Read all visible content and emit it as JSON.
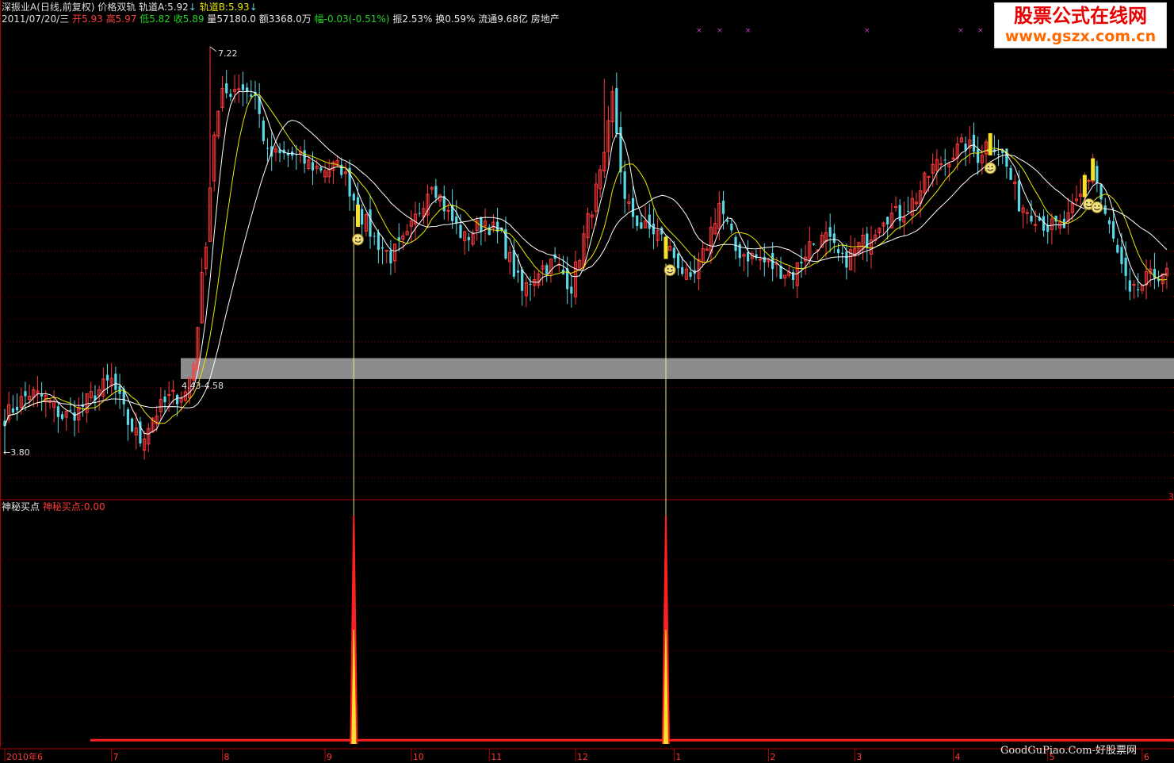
{
  "header": {
    "title": "深振业A(日线,前复权) 价格双轨",
    "track_a_label": "轨道A:",
    "track_a_value": "5.92",
    "track_b_label": "轨道B:",
    "track_b_value": "5.93",
    "arrow": "↓",
    "date": "2011/07/20/三",
    "open_label": "开",
    "open": "5.93",
    "high_label": "高",
    "high": "5.97",
    "low_label": "低",
    "low": "5.82",
    "close_label": "收",
    "close": "5.89",
    "volume_label": "量",
    "volume": "57180.0",
    "amount_label": "额",
    "amount": "3368.0万",
    "change_label": "幅",
    "change": "-0.03(-0.51%)",
    "amplitude": "振2.53%",
    "turnover": "换0.59%",
    "float": "流通9.68亿",
    "sector": "房地产"
  },
  "indicator": {
    "name": "神秘买点",
    "label": "神秘买点:",
    "value": "0.00",
    "right_mark": "3"
  },
  "watermark": {
    "cn": "股票公式在线网",
    "url": "www.gszx.com.cn"
  },
  "site_text": "GoodGuPiao.Com-好股票网",
  "colors": {
    "up": "#ff3b3b",
    "down": "#5ad8e6",
    "ma_white": "#ffffff",
    "ma_yellow": "#e8e800",
    "signal": "#ff2020",
    "support_band": "#8c8c8c",
    "grid": "#7a0000"
  },
  "chart_data": {
    "type": "candlestick",
    "price_range": [
      3.6,
      7.4
    ],
    "annotations": {
      "max_label": "7.22",
      "min_label": "3.80",
      "band_label": "4.43-4.58",
      "band_low": 4.43,
      "band_high": 4.58,
      "max_price": 7.22,
      "min_price": 3.8
    },
    "x_months": [
      "2010年6",
      "7",
      "8",
      "9",
      "10",
      "11",
      "12",
      "1",
      "2",
      "3",
      "4",
      "5",
      "6"
    ],
    "month_start_index": [
      0,
      26,
      53,
      78,
      99,
      118,
      139,
      163,
      186,
      207,
      231,
      254,
      277
    ],
    "price_waypoints": [
      [
        0,
        4.1
      ],
      [
        6,
        4.3
      ],
      [
        10,
        4.25
      ],
      [
        14,
        4.1
      ],
      [
        18,
        4.15
      ],
      [
        22,
        4.3
      ],
      [
        26,
        4.4
      ],
      [
        30,
        4.05
      ],
      [
        33,
        3.9
      ],
      [
        36,
        4.1
      ],
      [
        40,
        4.25
      ],
      [
        44,
        4.3
      ],
      [
        46,
        4.55
      ],
      [
        49,
        5.6
      ],
      [
        51,
        6.5
      ],
      [
        53,
        6.8
      ],
      [
        57,
        6.9
      ],
      [
        61,
        6.8
      ],
      [
        64,
        6.3
      ],
      [
        70,
        6.3
      ],
      [
        76,
        6.2
      ],
      [
        82,
        6.2
      ],
      [
        86,
        5.85
      ],
      [
        90,
        5.6
      ],
      [
        94,
        5.45
      ],
      [
        98,
        5.6
      ],
      [
        104,
        6.1
      ],
      [
        108,
        5.8
      ],
      [
        112,
        5.6
      ],
      [
        117,
        5.75
      ],
      [
        121,
        5.6
      ],
      [
        126,
        5.15
      ],
      [
        130,
        5.35
      ],
      [
        134,
        5.4
      ],
      [
        138,
        5.2
      ],
      [
        142,
        5.75
      ],
      [
        146,
        6.25
      ],
      [
        148,
        6.8
      ],
      [
        151,
        5.9
      ],
      [
        155,
        5.7
      ],
      [
        159,
        5.65
      ],
      [
        164,
        5.4
      ],
      [
        167,
        5.2
      ],
      [
        170,
        5.45
      ],
      [
        174,
        5.9
      ],
      [
        178,
        5.5
      ],
      [
        182,
        5.45
      ],
      [
        188,
        5.35
      ],
      [
        192,
        5.3
      ],
      [
        196,
        5.55
      ],
      [
        200,
        5.6
      ],
      [
        204,
        5.4
      ],
      [
        210,
        5.6
      ],
      [
        214,
        5.8
      ],
      [
        218,
        5.8
      ],
      [
        222,
        5.95
      ],
      [
        226,
        6.2
      ],
      [
        230,
        6.3
      ],
      [
        234,
        6.4
      ],
      [
        237,
        6.3
      ],
      [
        240,
        6.45
      ],
      [
        243,
        6.3
      ],
      [
        247,
        5.9
      ],
      [
        251,
        5.8
      ],
      [
        254,
        5.7
      ],
      [
        258,
        5.7
      ],
      [
        262,
        5.95
      ],
      [
        265,
        6.2
      ],
      [
        268,
        5.8
      ],
      [
        272,
        5.35
      ],
      [
        274,
        5.1
      ],
      [
        278,
        5.25
      ],
      [
        283,
        5.35
      ]
    ],
    "spikes": [
      [
        50,
        7.22
      ],
      [
        146,
        6.95
      ]
    ],
    "buy_signal_index": [
      85,
      161
    ],
    "smiley_index": [
      86,
      162,
      240,
      264,
      266
    ],
    "yellow_bar_index": [
      86,
      161,
      240,
      263,
      265
    ],
    "indicator_range": [
      0,
      3
    ],
    "indicator_peaks": [
      [
        85,
        3
      ],
      [
        161,
        3
      ]
    ],
    "indicator_flat": 0.05
  }
}
